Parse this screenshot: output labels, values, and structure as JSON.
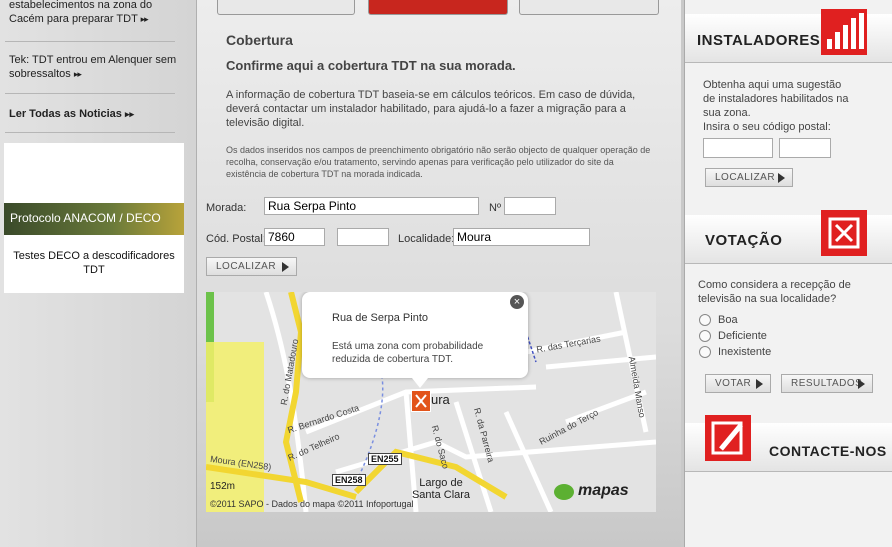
{
  "left": {
    "news1": "estabelecimentos na zona do Cacém para preparar TDT",
    "news1_more": "▸▸",
    "news2": "Tek: TDT entrou em Alenquer sem sobressaltos",
    "news2_more": "▸▸",
    "read_all": "Ler Todas as Noticias",
    "read_all_more": "▸▸",
    "promo_band": "Protocolo ANACOM / DECO",
    "promo_caption": "Testes DECO a descodificadores TDT"
  },
  "main": {
    "title": "Cobertura",
    "subtitle": "Confirme aqui a cobertura TDT na sua morada.",
    "intro": "A informação de cobertura TDT baseia-se em cálculos teóricos. Em caso de dúvida, deverá contactar um instalador habilitado, para ajudá-lo a fazer a migração para a televisão digital.",
    "legal": "Os dados inseridos nos campos de preenchimento obrigatório não serão objecto de qualquer operação de recolha, conservação e/ou tratamento, servindo apenas para verificação pelo utilizador do site da existência de cobertura TDT na morada indicada.",
    "form": {
      "morada_label": "Morada:",
      "morada_value": "Rua Serpa Pinto",
      "numero_label": "Nº",
      "numero_value": "",
      "codpostal_label": "Cód. Postal:",
      "cp1_value": "7860",
      "cp_dash": "-",
      "cp2_value": "",
      "localidade_label": "Localidade:",
      "localidade_value": "Moura",
      "localizar_button": "LOCALIZAR"
    },
    "map": {
      "popup_title": "Rua de Serpa Pinto",
      "popup_text": "Está uma zona com probabilidade reduzida de cobertura TDT.",
      "close": "×",
      "labels": {
        "moura": "ura",
        "bernardo": "R. Bernardo Costa",
        "telheiro": "R. do Telheiro",
        "matadouro": "R. do Matadouro",
        "saco": "R. do Saco",
        "parreira": "R. da Parreira",
        "tercarias": "R. das Terçarias",
        "ruinha": "Ruinha do Terço",
        "almeida": "Almeida Manso",
        "largo": "Largo de Santa Clara",
        "moura_en258": "Moura (EN258)",
        "en255": "EN255",
        "en258": "EN258",
        "scale": "152m",
        "mapas": "mapas"
      },
      "copyright": "©2011 SAPO - Dados do mapa ©2011 Infoportugal"
    }
  },
  "right": {
    "instaladores_title": "INSTALADORES",
    "instaladores_text": "Obtenha aqui uma sugestão de instaladores habilitados na sua zona.",
    "postal_prompt": "Insira o seu código postal:",
    "localizar_button": "LOCALIZAR",
    "votacao_title": "VOTAÇÃO",
    "poll_question": "Como considera a recepção de televisão na sua localidade?",
    "options": [
      "Boa",
      "Deficiente",
      "Inexistente"
    ],
    "votar_button": "VOTAR",
    "resultados_button": "RESULTADOS",
    "contacte_title": "CONTACTE-NOS"
  },
  "colors": {
    "accent": "#e02020"
  }
}
